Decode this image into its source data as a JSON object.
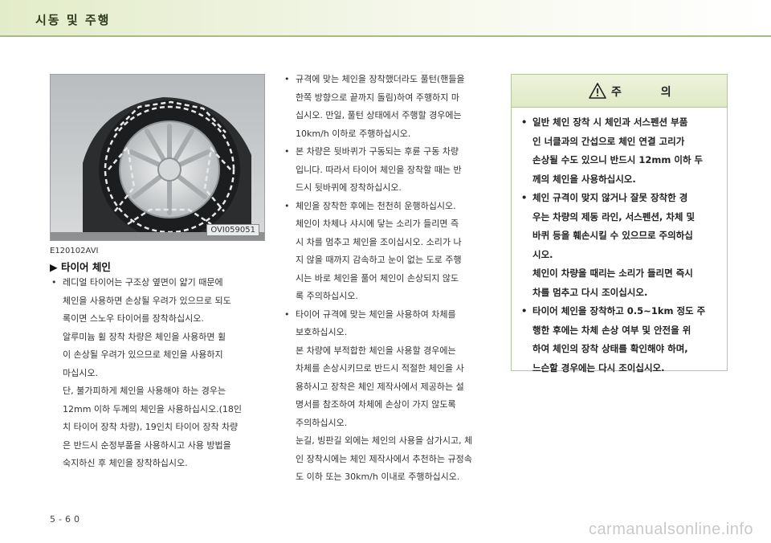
{
  "header": {
    "section_title": "시동 및 주행"
  },
  "figure": {
    "code": "OVI059051",
    "ref_id": "E120102AVI"
  },
  "section": {
    "heading": "▶ 타이어 체인"
  },
  "column1": [
    {
      "type": "bullet",
      "text": "레디얼 타이어는 구조상 옆면이 얇기 때문에"
    },
    {
      "type": "cont",
      "text": "체인을 사용하면 손상될 우려가 있으므로 되도"
    },
    {
      "type": "cont",
      "text": "록이면 스노우 타이어를 장착하십시오."
    },
    {
      "type": "cont",
      "text": "알루미늄 휠 장착 차량은 체인을 사용하면 휠"
    },
    {
      "type": "cont",
      "text": "이 손상될 우려가 있으므로 체인을 사용하지"
    },
    {
      "type": "cont",
      "text": "마십시오."
    },
    {
      "type": "cont",
      "text": "단, 불가피하게 체인을 사용해야 하는 경우는"
    },
    {
      "type": "cont",
      "text": "12mm 이하 두께의 체인을 사용하십시오.(18인"
    },
    {
      "type": "cont",
      "text": "치 타이어 장착 차량), 19인치 타이어 장착 차량"
    },
    {
      "type": "cont",
      "text": "은 반드시 순정부품을 사용하시고 사용 방법을"
    },
    {
      "type": "cont",
      "text": "숙지하신 후 체인을 장착하십시오."
    }
  ],
  "column2": [
    {
      "type": "bullet",
      "text": "규격에 맞는 체인을 장착했더라도 풀턴(핸들을"
    },
    {
      "type": "cont",
      "text": "한쪽 방향으로 끝까지 돌림)하여 주행하지 마"
    },
    {
      "type": "cont",
      "text": "십시오. 만일, 풀턴 상태에서 주행할 경우에는"
    },
    {
      "type": "cont",
      "text": "10km/h 이하로 주행하십시오."
    },
    {
      "type": "bullet",
      "text": "본 차량은 뒷바퀴가 구동되는 후륜 구동 차량"
    },
    {
      "type": "cont",
      "text": "입니다. 따라서 타이어 체인을 장착할 때는 반"
    },
    {
      "type": "cont",
      "text": "드시 뒷바퀴에 장착하십시오."
    },
    {
      "type": "bullet",
      "text": "체인을 장착한 후에는 천천히 운행하십시오."
    },
    {
      "type": "cont",
      "text": "체인이 차체나 샤시에 닿는 소리가 들리면 즉"
    },
    {
      "type": "cont",
      "text": "시 차를 멈추고 체인을 조이십시오. 소리가 나"
    },
    {
      "type": "cont",
      "text": "지 않을 때까지 감속하고 눈이 없는 도로 주행"
    },
    {
      "type": "cont",
      "text": "시는 바로 체인을 풀어 체인이 손상되지 않도"
    },
    {
      "type": "cont",
      "text": "록 주의하십시오."
    },
    {
      "type": "bullet",
      "text": "타이어 규격에 맞는 체인을 사용하여 차체를"
    },
    {
      "type": "cont",
      "text": "보호하십시오."
    },
    {
      "type": "cont",
      "text": "본 차량에 부적합한 체인을 사용할 경우에는"
    },
    {
      "type": "cont",
      "text": "차체를 손상시키므로 반드시 적절한 체인을 사"
    },
    {
      "type": "cont",
      "text": "용하시고 장착은 체인 제작사에서 제공하는 설"
    },
    {
      "type": "cont",
      "text": "명서를 참조하여 차체에 손상이 가지 않도록"
    },
    {
      "type": "cont",
      "text": "주의하십시오."
    },
    {
      "type": "cont",
      "text": "눈길, 빙판길 외에는 체인의 사용을 삼가시고, 체"
    },
    {
      "type": "cont",
      "text": "인 장착시에는 체인 제작사에서 추천하는 규정속"
    },
    {
      "type": "cont",
      "text": "도 이하 또는 30km/h 이내로 주행하십시오."
    }
  ],
  "caution": {
    "title": "주 의",
    "icon": "warning-triangle-icon",
    "lines": [
      {
        "type": "bullet",
        "text": "일반 체인 장착 시 체인과 서스펜션 부품"
      },
      {
        "type": "cont",
        "text": "인 너클과의 간섭으로 체인 연결 고리가"
      },
      {
        "type": "cont",
        "text": "손상될 수도 있으니 반드시 12mm 이하 두"
      },
      {
        "type": "cont",
        "text": "께의 체인을 사용하십시오."
      },
      {
        "type": "bullet",
        "text": "체인 규격이 맞지 않거나 잘못 장착한 경"
      },
      {
        "type": "cont",
        "text": "우는 차량의 제동 라인, 서스펜션, 차체 및"
      },
      {
        "type": "cont",
        "text": "바퀴 등을 훼손시킬 수 있으므로 주의하십"
      },
      {
        "type": "cont",
        "text": "시오."
      },
      {
        "type": "cont",
        "text": "체인이 차량을 때리는 소리가 들리면 즉시"
      },
      {
        "type": "cont",
        "text": "차를 멈추고 다시 조이십시오."
      },
      {
        "type": "bullet",
        "text": "타이어 체인을 장착하고 0.5~1km 정도 주"
      },
      {
        "type": "cont",
        "text": "행한 후에는 차체 손상 여부 및 안전을 위"
      },
      {
        "type": "cont",
        "text": "하여 체인의 장착 상태를 확인해야 하며,"
      },
      {
        "type": "cont",
        "text": "느슨할 경우에는 다시 조이십시오."
      }
    ]
  },
  "footer": {
    "page_number": "5-60",
    "watermark": "carmanualsonline.info"
  },
  "colors": {
    "header_green": "#e3ecc9",
    "border_green": "#b7c69a"
  }
}
